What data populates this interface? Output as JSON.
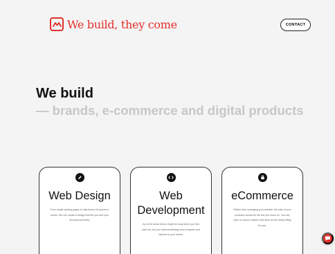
{
  "header": {
    "brand": "We build, they come",
    "contact_label": "CONTACT"
  },
  "hero": {
    "title": "We build",
    "subtitle": "— brands, e-commerce and digital products"
  },
  "services": [
    {
      "icon": "pencil-icon",
      "title": "Web Design",
      "description": "From single landing pages to fully-blown eCommerce stores. We can create a design that fits you and your business perfectly."
    },
    {
      "icon": "code-icon",
      "title_line1": "Web",
      "title_line2": "Development",
      "description": "As of the smart theme might be okay when you first start out, but you need something more bespoke and tailored to your needs."
    },
    {
      "icon": "shopping-bag-icon",
      "title": "eCommerce",
      "description": "Rather than managing your website, the sale of your products should be the first you focus on. You can have a custom solution that does all the heavy lifting for you."
    }
  ],
  "colors": {
    "brand": "#e1302b",
    "background": "#f4f4f4",
    "subtitle": "#c7c7c7"
  }
}
